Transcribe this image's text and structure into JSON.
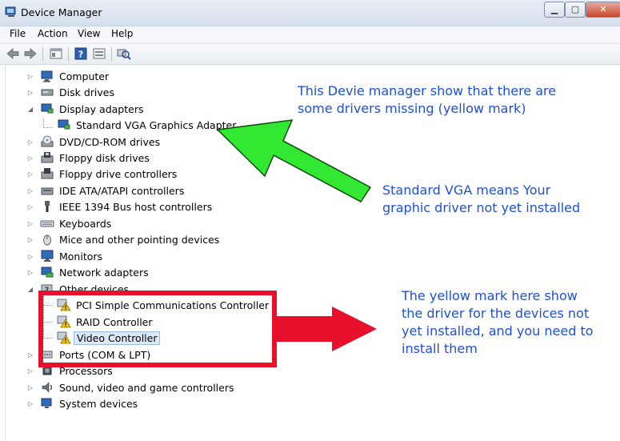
{
  "window": {
    "title": "Device Manager"
  },
  "menu": [
    {
      "label": "File"
    },
    {
      "label": "Action"
    },
    {
      "label": "View"
    },
    {
      "label": "Help"
    }
  ],
  "tree": {
    "items": [
      {
        "label": "Computer"
      },
      {
        "label": "Disk drives"
      },
      {
        "label": "Display adapters",
        "expanded": true
      },
      {
        "label": "Standard VGA Graphics Adapter",
        "child": true
      },
      {
        "label": "DVD/CD-ROM drives"
      },
      {
        "label": "Floppy disk drives"
      },
      {
        "label": "Floppy drive controllers"
      },
      {
        "label": "IDE ATA/ATAPI controllers"
      },
      {
        "label": "IEEE 1394 Bus host controllers"
      },
      {
        "label": "Keyboards"
      },
      {
        "label": "Mice and other pointing devices"
      },
      {
        "label": "Monitors"
      },
      {
        "label": "Network adapters"
      },
      {
        "label": "Other devices",
        "expanded": true
      },
      {
        "label": "PCI Simple Communications Controller",
        "child": true,
        "warning": true
      },
      {
        "label": "RAID Controller",
        "child": true,
        "warning": true
      },
      {
        "label": "Video Controller",
        "child": true,
        "warning": true,
        "selected": true
      },
      {
        "label": "Ports (COM & LPT)"
      },
      {
        "label": "Processors"
      },
      {
        "label": "Sound, video and game controllers"
      },
      {
        "label": "System devices"
      }
    ]
  },
  "annotations": {
    "note1": [
      "This Devie manager show that there are",
      "some drivers missing (yellow mark)"
    ],
    "note2": [
      "Standard VGA means Your",
      "graphic driver not yet installed"
    ],
    "note3": [
      "The yellow mark here show",
      "the driver for the devices not",
      "yet installed, and you need to",
      "install them"
    ]
  },
  "colors": {
    "note_text": "#1f4fd6",
    "green_arrow": "#33e833",
    "red_box": "#e8102a",
    "warning": "#f2c400"
  }
}
